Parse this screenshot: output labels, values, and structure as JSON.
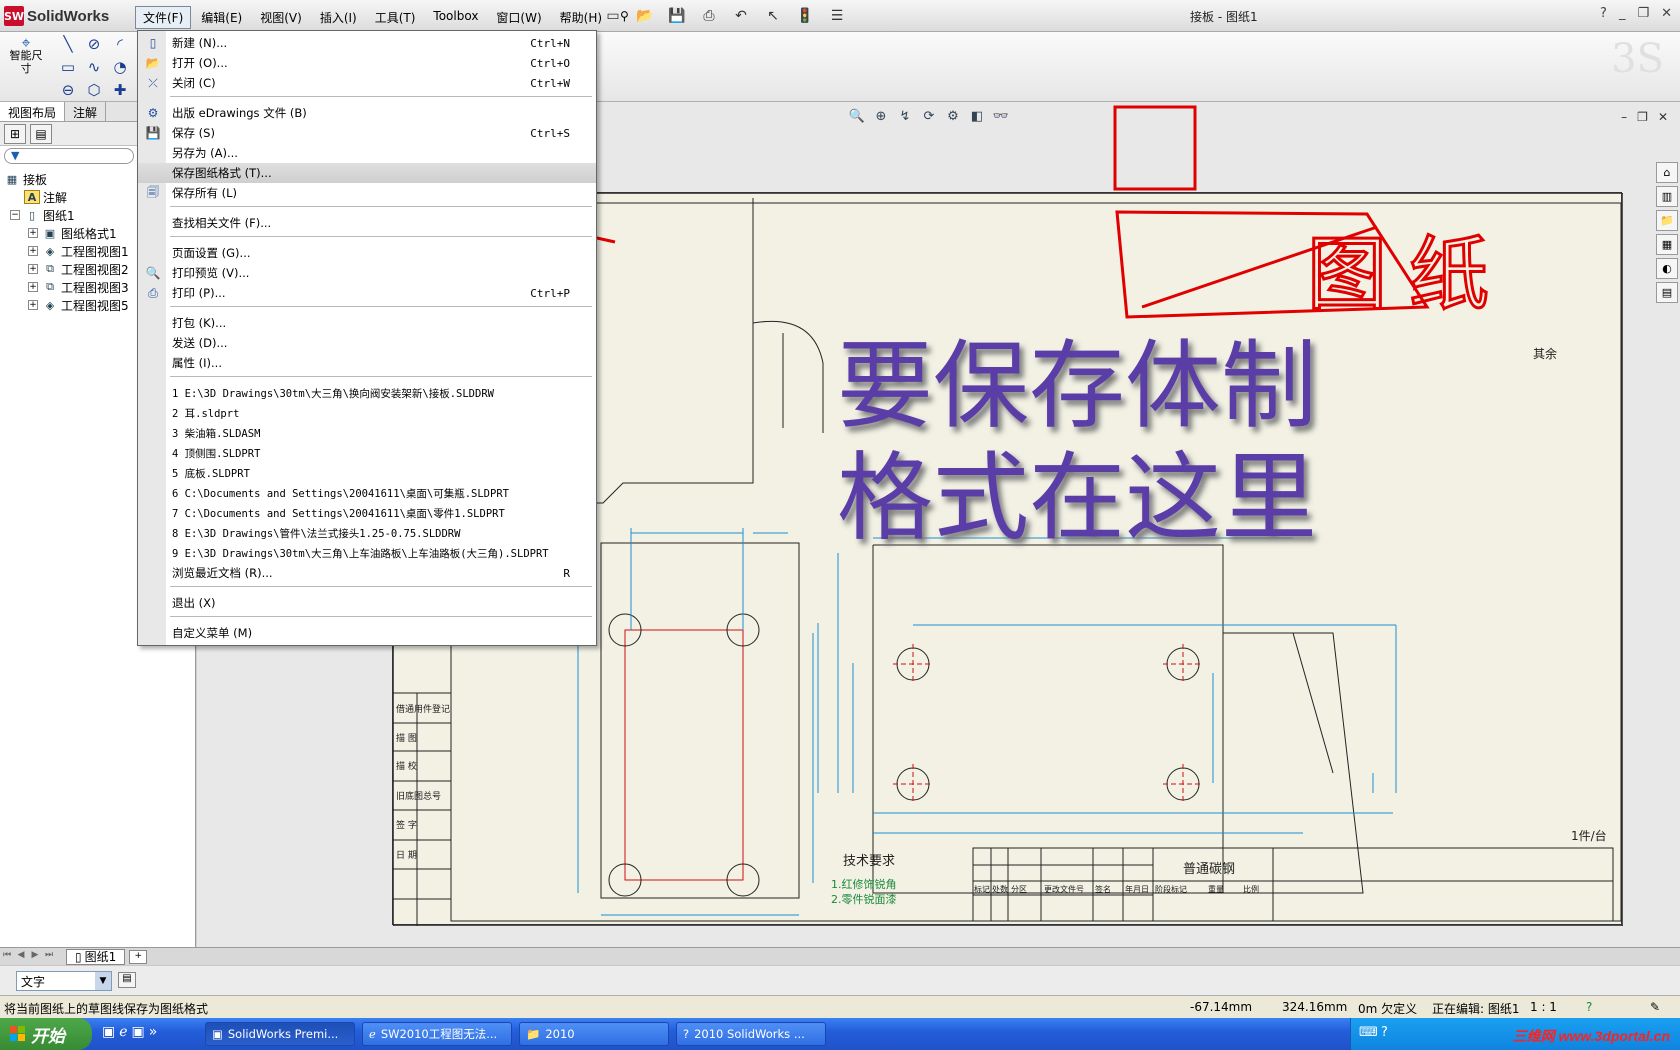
{
  "app": {
    "logo_text": "SolidWorks",
    "document_title": "接板 - 图纸1"
  },
  "menubar": [
    "文件(F)",
    "编辑(E)",
    "视图(V)",
    "插入(I)",
    "工具(T)",
    "Toolbox",
    "窗口(W)",
    "帮助(H)"
  ],
  "command_manager": {
    "smart_dimension": "智能尺寸",
    "tabs": [
      "视图布局",
      "注解"
    ]
  },
  "feature_tree": {
    "filter_placeholder": "",
    "nodes": [
      {
        "label": "接板",
        "level": 0
      },
      {
        "label": "注解",
        "level": 1
      },
      {
        "label": "图纸1",
        "level": 0,
        "expand": "−"
      },
      {
        "label": "图纸格式1",
        "level": 2,
        "expand": "+"
      },
      {
        "label": "工程图视图1",
        "level": 2,
        "expand": "+"
      },
      {
        "label": "工程图视图2",
        "level": 2,
        "expand": "+"
      },
      {
        "label": "工程图视图3",
        "level": 2,
        "expand": "+"
      },
      {
        "label": "工程图视图5",
        "level": 2,
        "expand": "+"
      }
    ]
  },
  "file_menu": {
    "items": [
      {
        "label": "新建 (N)...",
        "shortcut": "Ctrl+N",
        "icon": "new-file-icon"
      },
      {
        "label": "打开 (O)...",
        "shortcut": "Ctrl+O",
        "icon": "open-folder-icon"
      },
      {
        "label": "关闭 (C)",
        "shortcut": "Ctrl+W",
        "icon": "close-file-icon"
      },
      {
        "label": "出版 eDrawings 文件 (B)",
        "shortcut": "",
        "icon": "edrawings-icon"
      },
      {
        "label": "保存 (S)",
        "shortcut": "Ctrl+S",
        "icon": "save-icon"
      },
      {
        "label": "另存为 (A)...",
        "shortcut": "",
        "icon": ""
      },
      {
        "label": "保存图纸格式 (T)...",
        "shortcut": "",
        "icon": "",
        "highlight": true
      },
      {
        "label": "保存所有 (L)",
        "shortcut": "",
        "icon": "save-all-icon"
      },
      {
        "label": "查找相关文件 (F)...",
        "shortcut": "",
        "icon": ""
      },
      {
        "label": "页面设置 (G)...",
        "shortcut": "",
        "icon": ""
      },
      {
        "label": "打印预览 (V)...",
        "shortcut": "",
        "icon": "print-preview-icon"
      },
      {
        "label": "打印 (P)...",
        "shortcut": "Ctrl+P",
        "icon": "print-icon"
      },
      {
        "label": "打包 (K)...",
        "shortcut": "",
        "icon": ""
      },
      {
        "label": "发送 (D)...",
        "shortcut": "",
        "icon": ""
      },
      {
        "label": "属性 (I)...",
        "shortcut": "",
        "icon": ""
      },
      {
        "label": "1 E:\\3D Drawings\\30tm\\大三角\\换向阀安装架新\\接板.SLDDRW",
        "shortcut": "",
        "icon": "",
        "mono": true
      },
      {
        "label": "2 耳.sldprt",
        "shortcut": "",
        "icon": "",
        "mono": true
      },
      {
        "label": "3 柴油箱.SLDASM",
        "shortcut": "",
        "icon": "",
        "mono": true
      },
      {
        "label": "4 顶侧围.SLDPRT",
        "shortcut": "",
        "icon": "",
        "mono": true
      },
      {
        "label": "5 底板.SLDPRT",
        "shortcut": "",
        "icon": "",
        "mono": true
      },
      {
        "label": "6 C:\\Documents and Settings\\20041611\\桌面\\可集瓶.SLDPRT",
        "shortcut": "",
        "icon": "",
        "mono": true
      },
      {
        "label": "7 C:\\Documents and Settings\\20041611\\桌面\\零件1.SLDPRT",
        "shortcut": "",
        "icon": "",
        "mono": true
      },
      {
        "label": "8 E:\\3D Drawings\\管件\\法兰式接头1.25-0.75.SLDDRW",
        "shortcut": "",
        "icon": "",
        "mono": true
      },
      {
        "label": "9 E:\\3D Drawings\\30tm\\大三角\\上车油路板\\上车油路板(大三角).SLDPRT",
        "shortcut": "",
        "icon": "",
        "mono": true
      },
      {
        "label": "浏览最近文档 (R)...",
        "shortcut": "R",
        "icon": ""
      },
      {
        "label": "退出 (X)",
        "shortcut": "",
        "icon": ""
      },
      {
        "label": "自定义菜单 (M)",
        "shortcut": "",
        "icon": ""
      }
    ]
  },
  "annotations": {
    "title_overlay": "图纸",
    "instruction_line1": "要保存体制",
    "instruction_line2": "格式在这里",
    "color": "#e10000",
    "instruction_color": "#5a3da6"
  },
  "drawing": {
    "tech_req_title": "技术要求",
    "tech_req_1": "1.红修饰锐角",
    "tech_req_2": "2.零件锐面漆",
    "material": "普通碳钢",
    "surface_rest": "其余",
    "qty_label": "1件/台",
    "sidebar_labels": [
      "借通用件登记",
      "描  图",
      "描  校",
      "旧底图总号",
      "签  字",
      "日  期"
    ],
    "title_block_labels": [
      "标记",
      "处数",
      "分区",
      "更改文件号",
      "签名",
      "年月日",
      "阶段标记",
      "重量",
      "比例"
    ]
  },
  "sheet_tab": "图纸1",
  "font_selector": "文字",
  "status": {
    "message": "将当前图纸上的草图线保存为图纸格式",
    "x": "-67.14mm",
    "y": "324.16mm",
    "z": "0m 欠定义",
    "editing": "正在编辑: 图纸1",
    "scale": "1 : 1"
  },
  "taskbar": {
    "start": "开始",
    "buttons": [
      "SolidWorks Premi...",
      "SW2010工程图无法...",
      "2010",
      "2010 SolidWorks ..."
    ],
    "watermark": "三维网 www.3dportal.cn"
  }
}
